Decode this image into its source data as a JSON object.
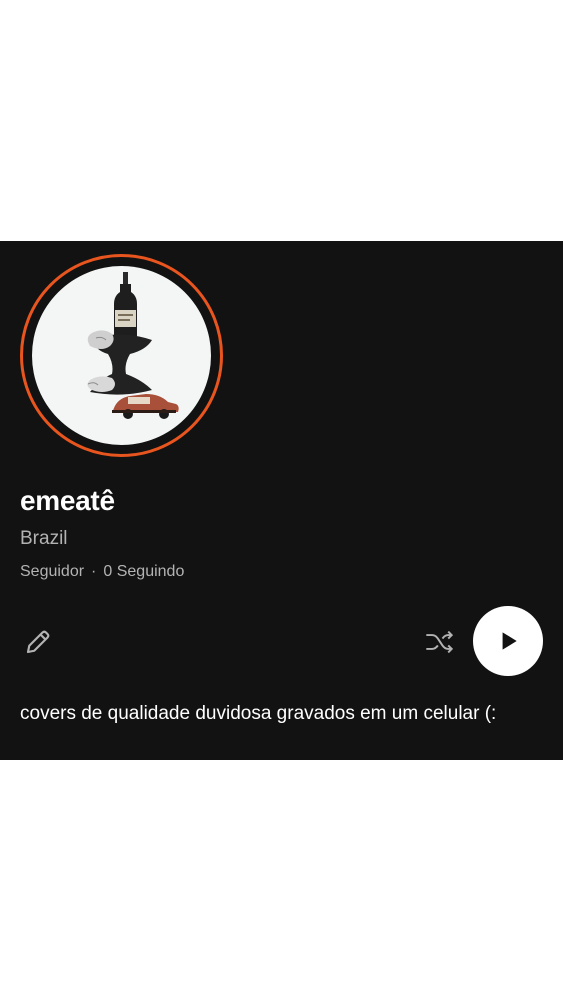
{
  "profile": {
    "name": "emeatê",
    "country": "Brazil",
    "followers_label": "Seguidor",
    "separator": "·",
    "following_label": "0 Seguindo",
    "bio": "covers de qualidade duvidosa gravados em um celular (:",
    "accent_color": "#e8551e"
  },
  "actions": {
    "edit_icon": "pencil-icon",
    "shuffle_icon": "shuffle-icon",
    "play_icon": "play-icon"
  }
}
